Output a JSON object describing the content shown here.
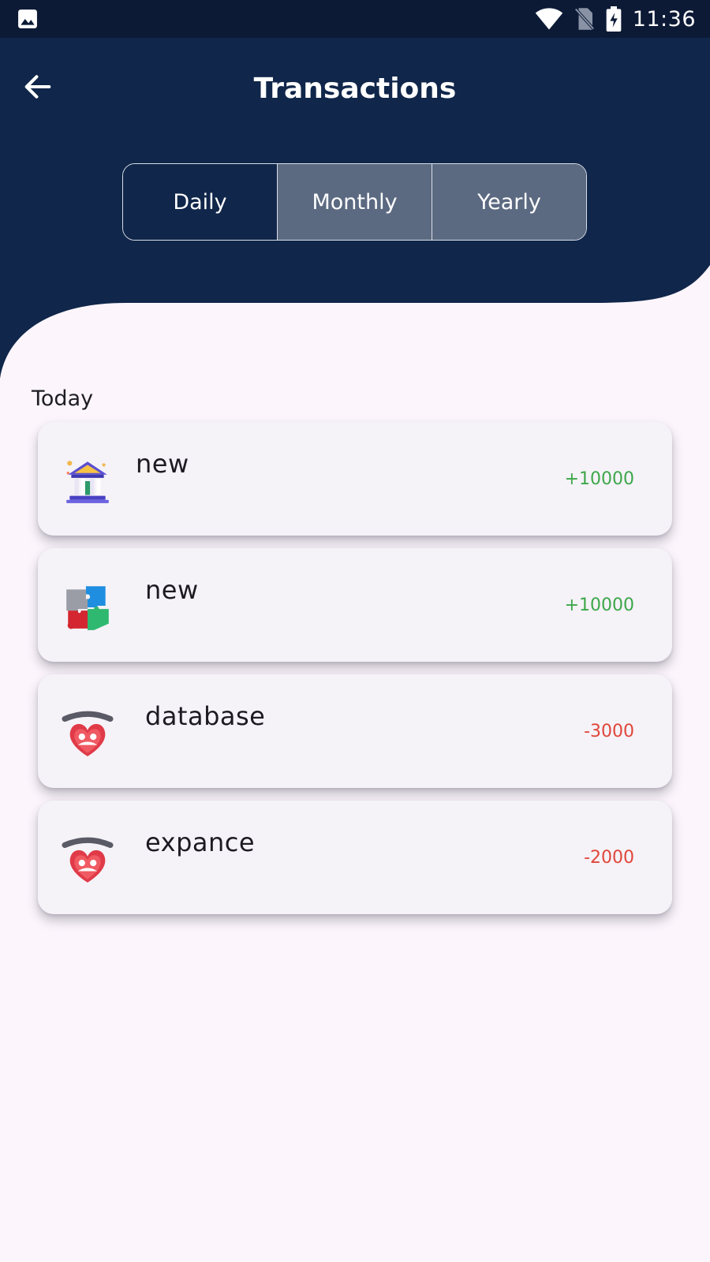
{
  "status_bar": {
    "time": "11:36",
    "icons": [
      "gallery-icon",
      "wifi-icon",
      "no-sim-icon",
      "battery-charging-icon"
    ]
  },
  "header": {
    "title": "Transactions",
    "back_icon": "arrow-left-icon",
    "background_color": "#10264a"
  },
  "tabs": [
    {
      "label": "Daily",
      "active": true
    },
    {
      "label": "Monthly",
      "active": false
    },
    {
      "label": "Yearly",
      "active": false
    }
  ],
  "section": {
    "label": "Today"
  },
  "transactions": [
    {
      "name": "new",
      "amount": "+10000",
      "icon": "bank-icon",
      "type": "income"
    },
    {
      "name": "new",
      "amount": "+10000",
      "icon": "puzzle-icon",
      "type": "income"
    },
    {
      "name": "database",
      "amount": "-3000",
      "icon": "family-heart-icon",
      "type": "expense"
    },
    {
      "name": "expance",
      "amount": "-2000",
      "icon": "family-heart-icon",
      "type": "expense"
    }
  ],
  "colors": {
    "income": "#3da74a",
    "expense": "#e0463a",
    "background": "#fcf5fc"
  }
}
